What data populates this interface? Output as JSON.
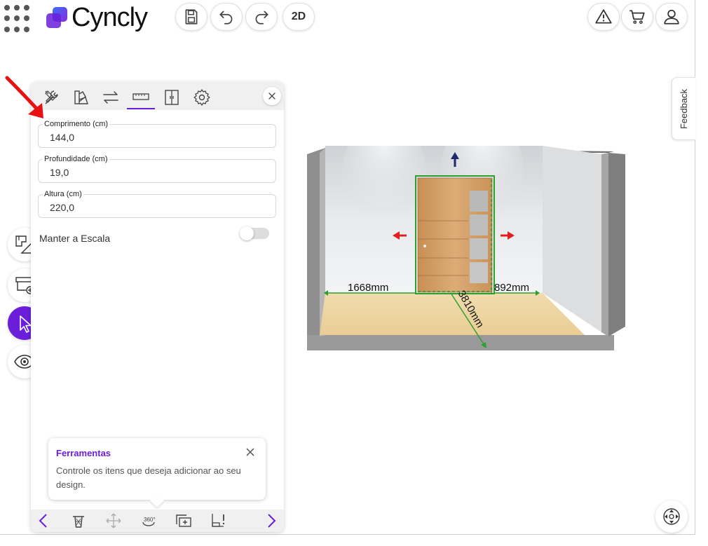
{
  "app": {
    "name": "Cyncly"
  },
  "header": {
    "save_icon": "save-icon",
    "undo_icon": "undo-icon",
    "redo_icon": "redo-icon",
    "view_mode_label": "2D",
    "warning_icon": "warning-icon",
    "cart_icon": "cart-icon",
    "user_icon": "user-icon"
  },
  "feedback": {
    "label": "Feedback"
  },
  "panel": {
    "tabs": [
      {
        "icon": "tools-icon"
      },
      {
        "icon": "color-palette-icon"
      },
      {
        "icon": "swap-icon"
      },
      {
        "icon": "ruler-icon",
        "active": true
      },
      {
        "icon": "wardrobe-icon"
      },
      {
        "icon": "gear-icon"
      }
    ],
    "fields": {
      "length": {
        "label": "Comprimento (cm)",
        "value": "144,0"
      },
      "depth": {
        "label": "Profundidade (cm)",
        "value": "19,0"
      },
      "height": {
        "label": "Altura (cm)",
        "value": "220,0"
      }
    },
    "keep_scale": {
      "label": "Manter a Escala",
      "on": false
    }
  },
  "tooltip": {
    "title": "Ferramentas",
    "text": "Controle os itens que deseja adicionar ao seu design."
  },
  "scene": {
    "dim_left": "1668mm",
    "dim_right": "892mm",
    "dim_depth": "3810mm"
  },
  "colors": {
    "accent": "#6a1ed9",
    "selection_green": "#2e9e2e",
    "arrow_red": "#e02020"
  }
}
